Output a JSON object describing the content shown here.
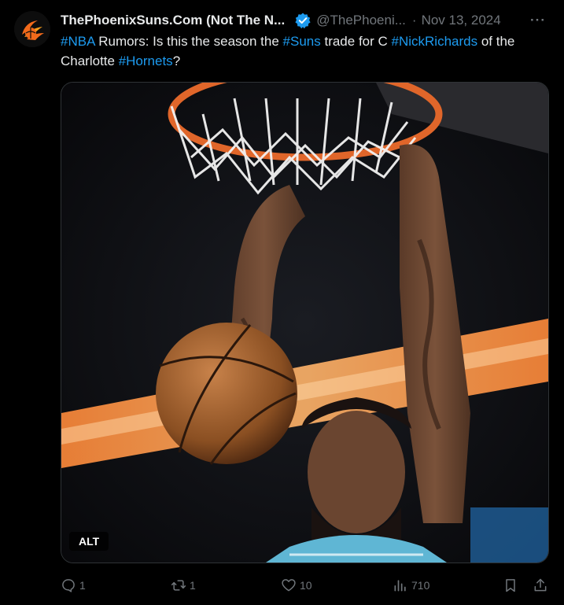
{
  "author": {
    "display_name": "ThePhoenixSuns.Com (Not The N...",
    "handle": "@ThePhoeni...",
    "separator": "·",
    "date": "Nov 13, 2024",
    "verified": true,
    "avatar_icon": "suns-logo-icon"
  },
  "tweet": {
    "segments": [
      {
        "text": "#NBA",
        "hashtag": true
      },
      {
        "text": " Rumors: Is this the season the ",
        "hashtag": false
      },
      {
        "text": "#Suns",
        "hashtag": true
      },
      {
        "text": " trade for C ",
        "hashtag": false
      },
      {
        "text": "#NickRichards",
        "hashtag": true
      },
      {
        "text": " of the Charlotte ",
        "hashtag": false
      },
      {
        "text": "#Hornets",
        "hashtag": true
      },
      {
        "text": "?",
        "hashtag": false
      }
    ]
  },
  "media": {
    "alt_label": "ALT"
  },
  "actions": {
    "more_label": "···",
    "replies": "1",
    "retweets": "1",
    "likes": "10",
    "views": "710"
  },
  "colors": {
    "background": "#000000",
    "text": "#e7e9ea",
    "muted": "#71767b",
    "accent": "#1d9bf0"
  }
}
